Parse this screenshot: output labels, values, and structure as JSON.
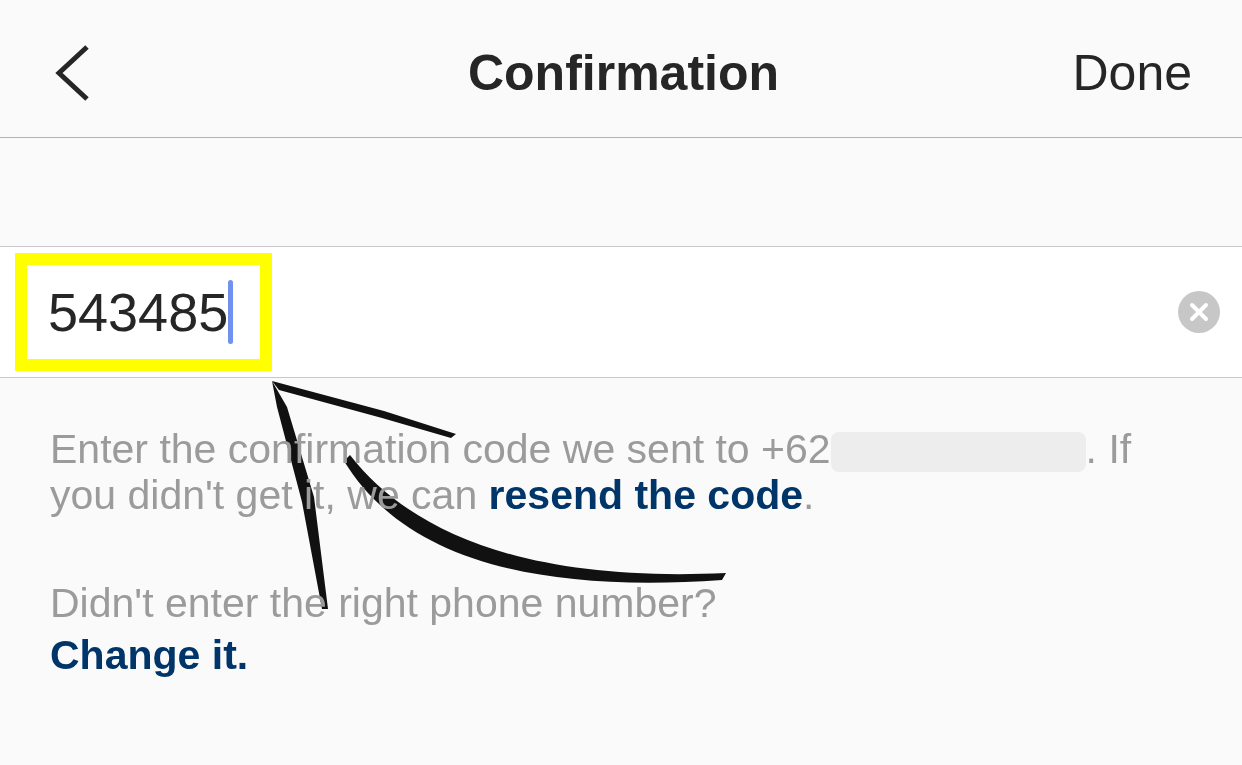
{
  "nav_bar": {
    "title": "Confirmation",
    "done": "Done"
  },
  "code_field": {
    "value": "543485",
    "focused": true,
    "highlighted": true
  },
  "instructions": [
    {
      "kind": "text",
      "text": "Enter the confirmation code we sent to +62"
    },
    {
      "kind": "redacted"
    },
    {
      "kind": "text",
      "text": ". If you didn't get it, we can "
    },
    {
      "kind": "link",
      "text": "resend the code"
    },
    {
      "kind": "text",
      "text": "."
    }
  ],
  "wrong_number": {
    "question": "Didn't enter the right phone number?",
    "link": "Change it."
  },
  "annotation": {
    "arrow": true
  }
}
